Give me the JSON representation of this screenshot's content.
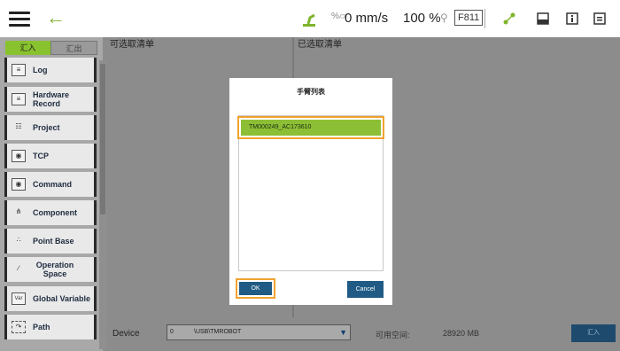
{
  "topbar": {
    "speed": "0 mm/s",
    "percent": "100 %",
    "key_code": "F811"
  },
  "sidebar": {
    "tabs": [
      {
        "label": "汇入",
        "active": true
      },
      {
        "label": "汇出",
        "active": false
      }
    ],
    "items": [
      {
        "label": "Log",
        "icon": "log-icon"
      },
      {
        "label": "Hardware Record",
        "icon": "hardware-record-icon"
      },
      {
        "label": "Project",
        "icon": "project-icon"
      },
      {
        "label": "TCP",
        "icon": "tcp-icon"
      },
      {
        "label": "Command",
        "icon": "command-icon"
      },
      {
        "label": "Component",
        "icon": "component-icon"
      },
      {
        "label": "Point Base",
        "icon": "point-base-icon"
      },
      {
        "label": "Operation Space",
        "icon": "operation-space-icon"
      },
      {
        "label": "Global Variable",
        "icon": "global-variable-icon",
        "icon_text": "Var"
      },
      {
        "label": "Path",
        "icon": "path-icon"
      }
    ]
  },
  "columns": {
    "selectable": "可选取清单",
    "selected": "已选取清单"
  },
  "bottom": {
    "device_label": "Device",
    "device_number": "0",
    "device_path": "\\USB\\TMROBOT",
    "space_label": "可用空间:",
    "space_value": "28920 MB",
    "import_label": "汇入"
  },
  "dialog": {
    "title": "手臂列表",
    "items": [
      "TM000249_AC173610"
    ],
    "ok_label": "OK",
    "cancel_label": "Cancel"
  },
  "colors": {
    "accent_green": "#8cbf35",
    "highlight_orange": "#f0a32e",
    "button_blue": "#1f5b84"
  }
}
